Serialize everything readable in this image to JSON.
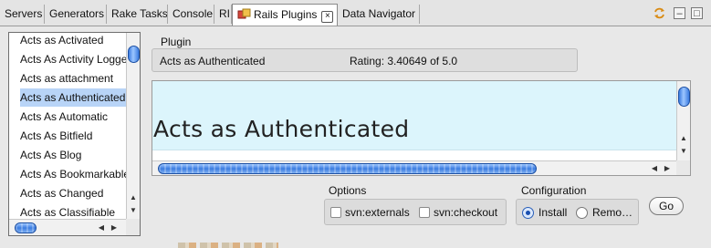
{
  "tabs": [
    {
      "label": "Servers"
    },
    {
      "label": "Generators"
    },
    {
      "label": "Rake Tasks"
    },
    {
      "label": "Console"
    },
    {
      "label": "RI"
    },
    {
      "label": "Rails Plugins"
    },
    {
      "label": "Data Navigator"
    }
  ],
  "tab_controls": {
    "sync_icon": "sync-icon",
    "minimize": "–",
    "maximize": "□"
  },
  "plugins": [
    "Acts as Activated",
    "Acts As Activity Logger",
    "Acts as attachment",
    "Acts as Authenticated",
    "Acts As Automatic",
    "Acts As Bitfield",
    "Acts As Blog",
    "Acts As Bookmarkable",
    "Acts as Changed",
    "Acts as Classifiable"
  ],
  "plugin_section": {
    "label": "Plugin",
    "name": "Acts as Authenticated",
    "rating": "Rating: 3.40649 of 5.0"
  },
  "browser": {
    "heading": "Acts as Authenticated"
  },
  "options": {
    "label": "Options",
    "svn_externals": "svn:externals",
    "svn_checkout": "svn:checkout",
    "svn_externals_checked": false,
    "svn_checkout_checked": false
  },
  "configuration": {
    "label": "Configuration",
    "install": "Install",
    "remove": "Remo…",
    "selected": "install"
  },
  "go_label": "Go",
  "colors": {
    "accent": "#3b7ce0",
    "page_bg": "#dcf5fc",
    "selection": "#b8d4f7"
  }
}
